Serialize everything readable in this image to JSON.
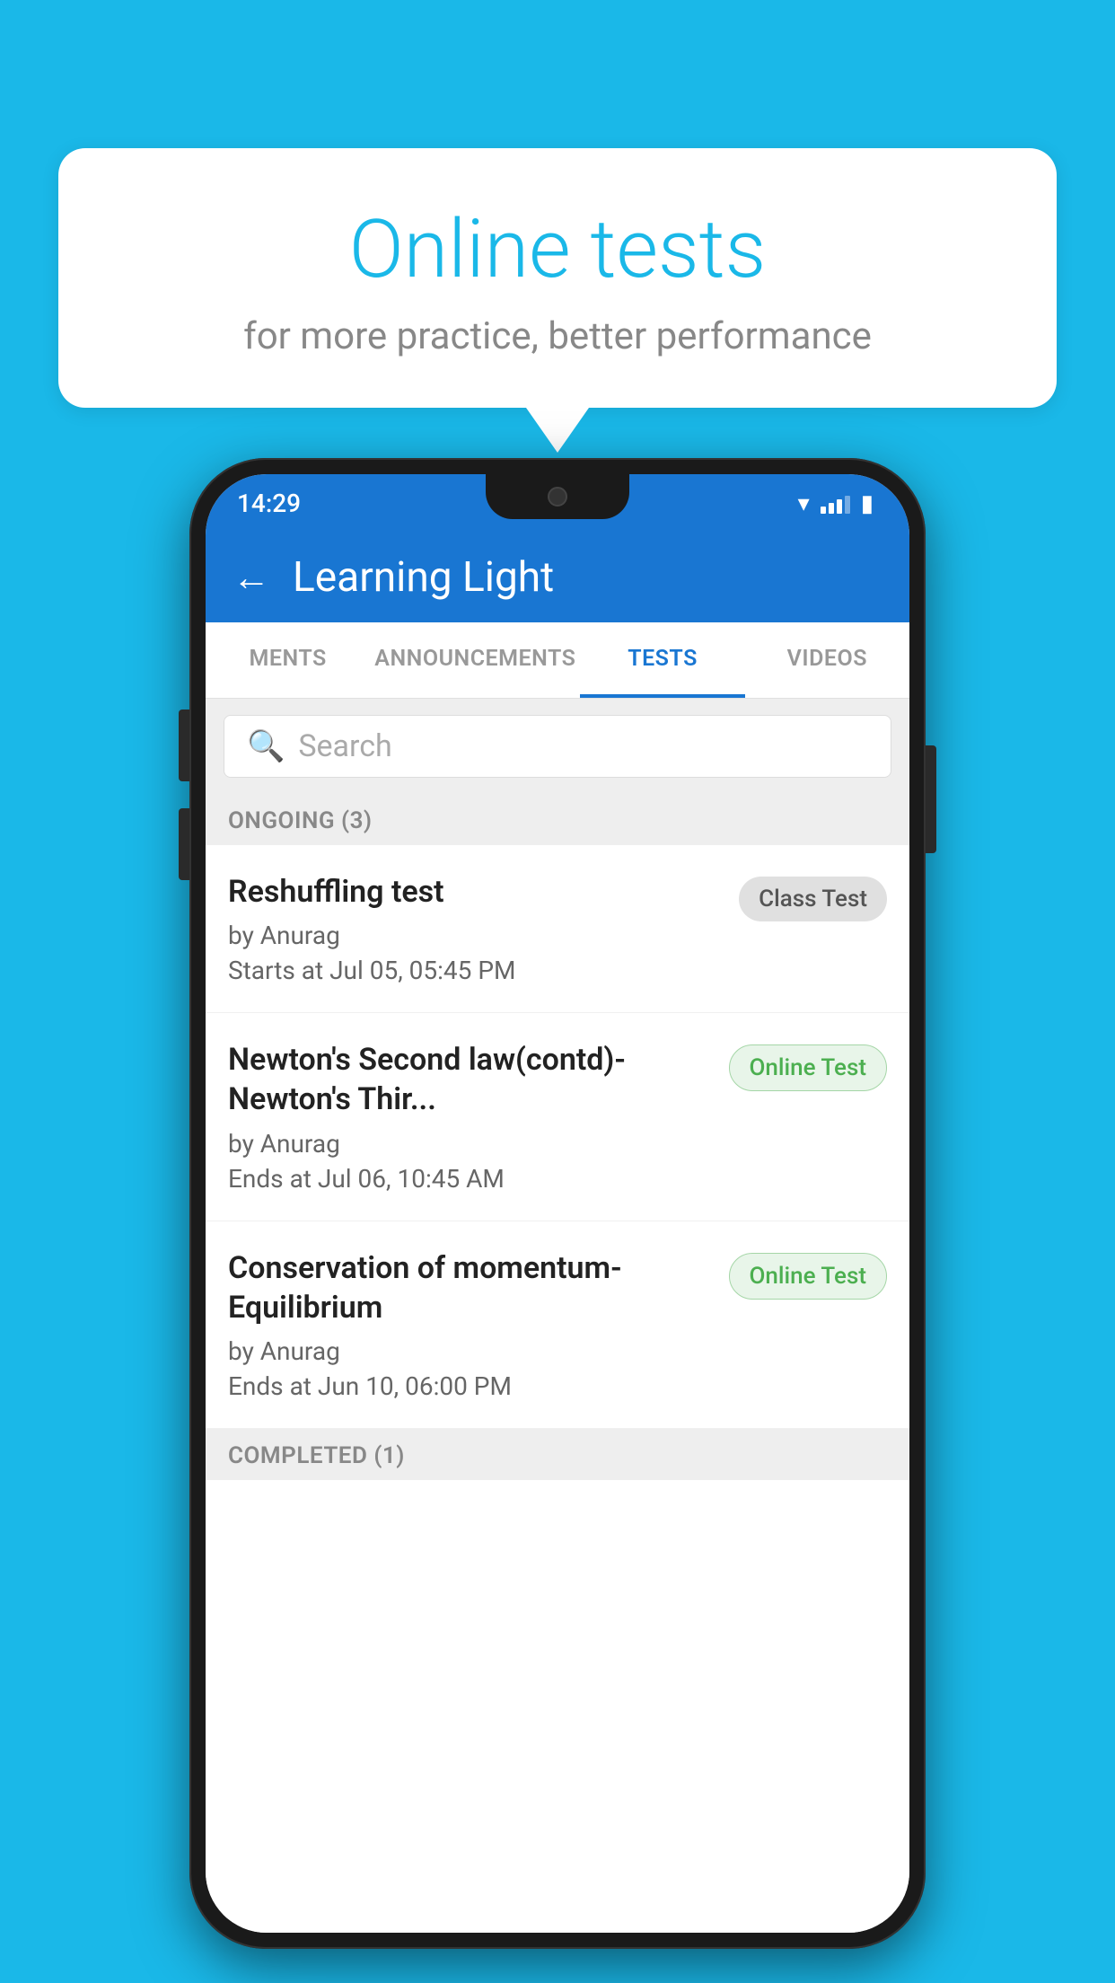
{
  "background": {
    "color": "#1ab8e8"
  },
  "speech_bubble": {
    "title": "Online tests",
    "subtitle": "for more practice, better performance"
  },
  "phone": {
    "status_bar": {
      "time": "14:29",
      "wifi": "▼",
      "signal": "▲",
      "battery": "▮"
    },
    "app_bar": {
      "title": "Learning Light",
      "back_label": "←"
    },
    "tabs": [
      {
        "label": "MENTS",
        "active": false
      },
      {
        "label": "ANNOUNCEMENTS",
        "active": false
      },
      {
        "label": "TESTS",
        "active": true
      },
      {
        "label": "VIDEOS",
        "active": false
      }
    ],
    "search": {
      "placeholder": "Search"
    },
    "ongoing_section": {
      "label": "ONGOING (3)"
    },
    "tests": [
      {
        "name": "Reshuffling test",
        "author": "by Anurag",
        "date": "Starts at  Jul 05, 05:45 PM",
        "badge": "Class Test",
        "badge_type": "class"
      },
      {
        "name": "Newton's Second law(contd)-Newton's Thir...",
        "author": "by Anurag",
        "date": "Ends at  Jul 06, 10:45 AM",
        "badge": "Online Test",
        "badge_type": "online"
      },
      {
        "name": "Conservation of momentum-Equilibrium",
        "author": "by Anurag",
        "date": "Ends at  Jun 10, 06:00 PM",
        "badge": "Online Test",
        "badge_type": "online"
      }
    ],
    "completed_section": {
      "label": "COMPLETED (1)"
    }
  }
}
